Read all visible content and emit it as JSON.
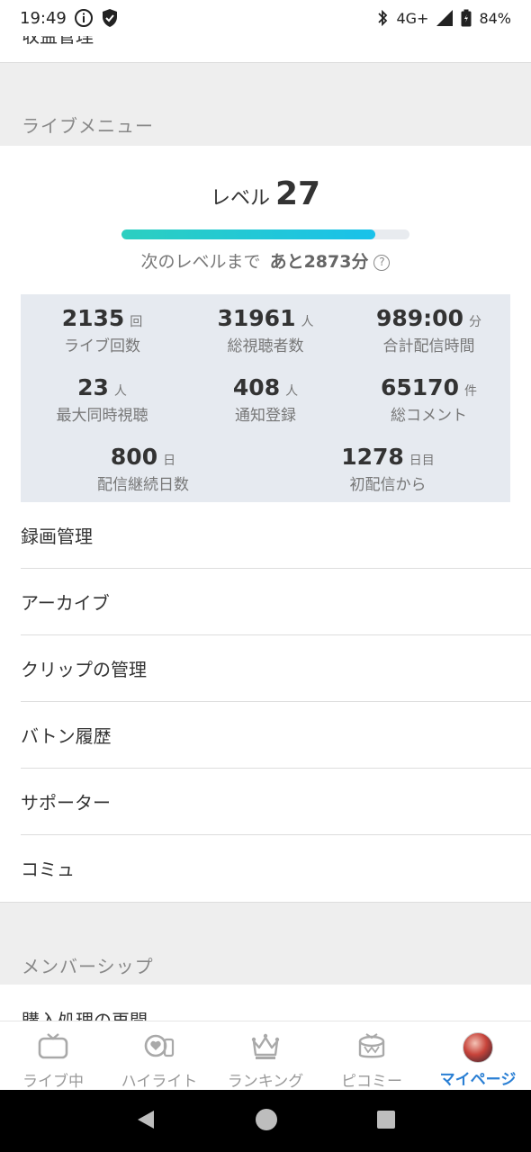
{
  "status_bar": {
    "time": "19:49",
    "network": "4G+",
    "battery": "84%"
  },
  "top_partial_label": "収益管理",
  "live_menu": {
    "header": "ライブメニュー",
    "level_label": "レベル",
    "level_value": "27",
    "progress_fraction": 0.88,
    "next_level_text": "次のレベルまで",
    "remaining_text": "あと2873分",
    "stats": [
      {
        "value": "2135",
        "unit": "回",
        "label": "ライブ回数"
      },
      {
        "value": "31961",
        "unit": "人",
        "label": "総視聴者数"
      },
      {
        "value": "989:00",
        "unit": "分",
        "label": "合計配信時間"
      },
      {
        "value": "23",
        "unit": "人",
        "label": "最大同時視聴"
      },
      {
        "value": "408",
        "unit": "人",
        "label": "通知登録"
      },
      {
        "value": "65170",
        "unit": "件",
        "label": "総コメント"
      },
      {
        "value": "800",
        "unit": "日",
        "label": "配信継続日数"
      },
      {
        "value": "1278",
        "unit": "日目",
        "label": "初配信から"
      }
    ],
    "items": [
      {
        "label": "録画管理"
      },
      {
        "label": "アーカイブ"
      },
      {
        "label": "クリップの管理"
      },
      {
        "label": "バトン履歴"
      },
      {
        "label": "サポーター"
      },
      {
        "label": "コミュ"
      }
    ]
  },
  "membership": {
    "header": "メンバーシップ",
    "partial_item": "購入処理の再開"
  },
  "tabs": [
    {
      "label": "ライブ中",
      "icon": "tv-icon",
      "active": false
    },
    {
      "label": "ハイライト",
      "icon": "highlight-icon",
      "active": false
    },
    {
      "label": "ランキング",
      "icon": "crown-icon",
      "active": false
    },
    {
      "label": "ピコミー",
      "icon": "picomy-icon",
      "active": false
    },
    {
      "label": "マイページ",
      "icon": "avatar",
      "active": true
    }
  ],
  "colors": {
    "accent": "#2a7fd4",
    "progress_start": "#2ccfc0",
    "progress_end": "#19c1ea"
  }
}
